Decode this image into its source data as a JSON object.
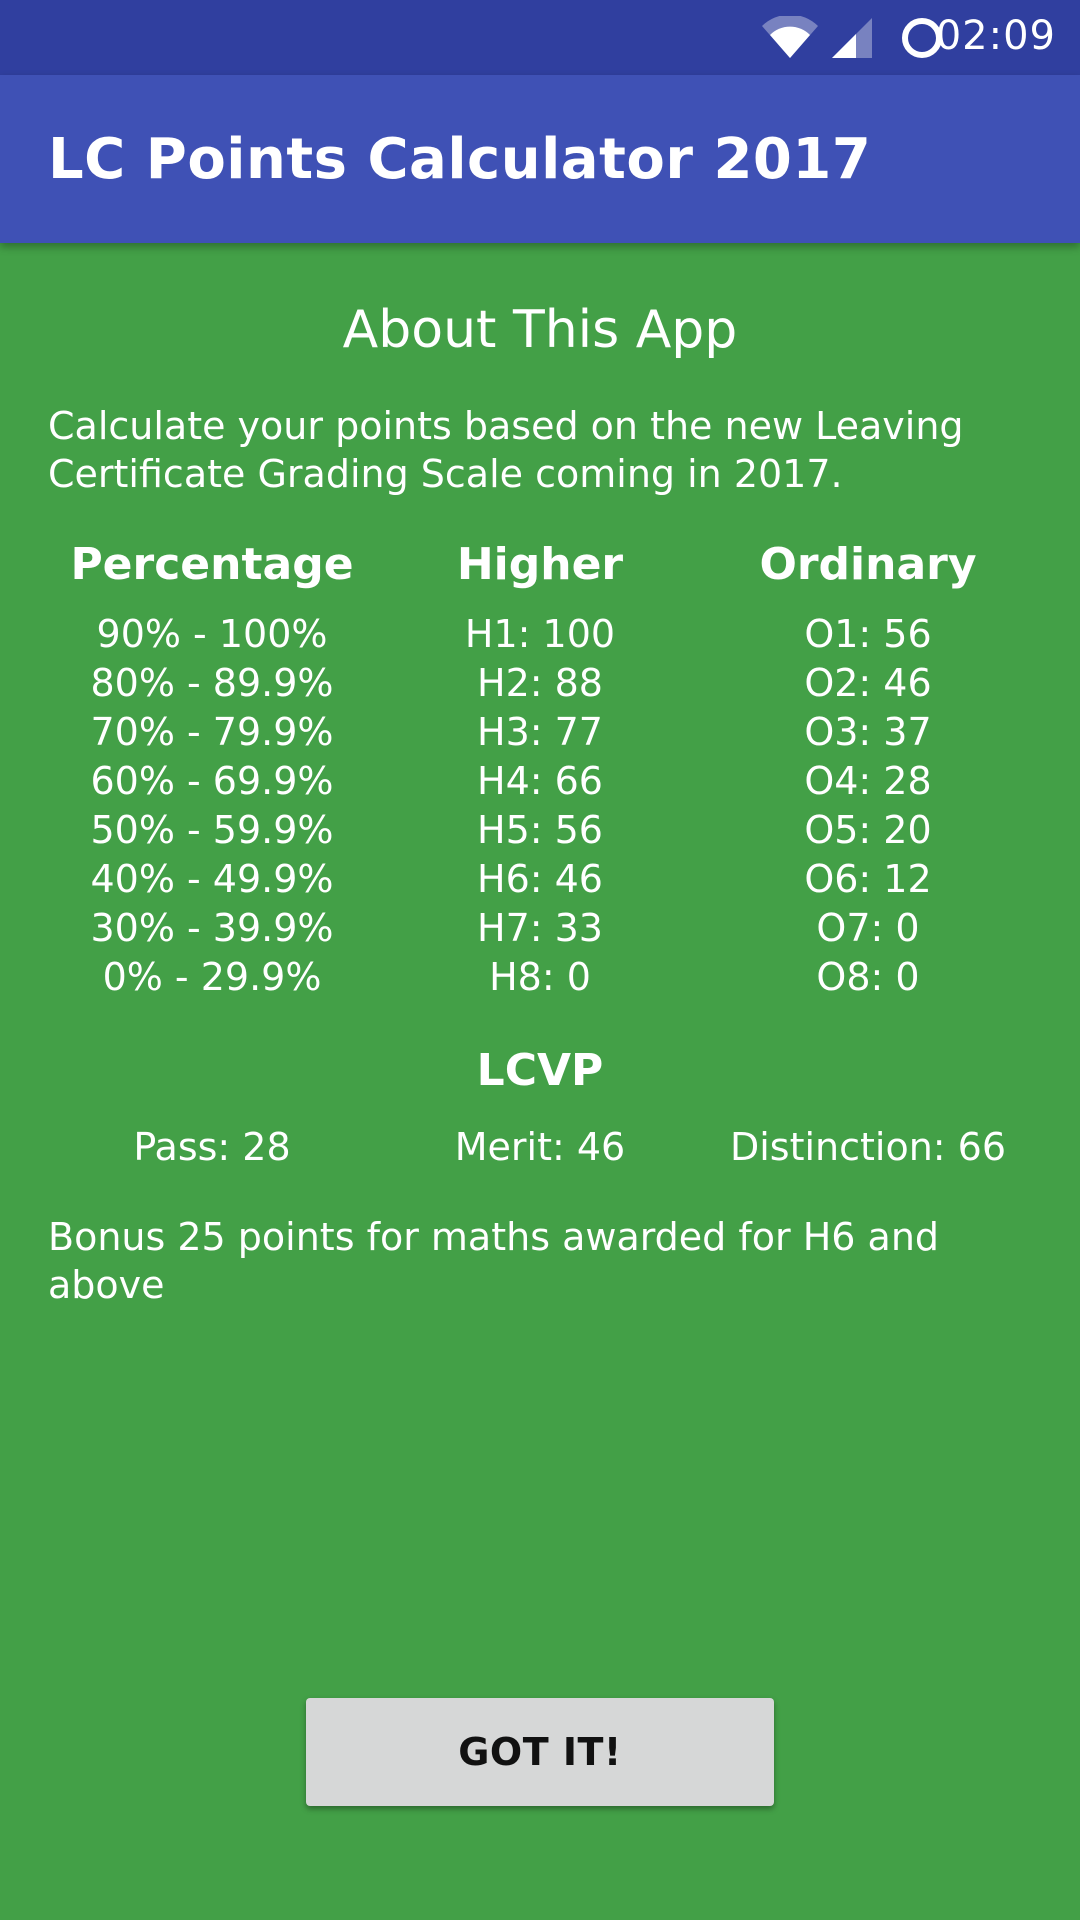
{
  "status_bar": {
    "time": "02:09",
    "icons": [
      "wifi-icon",
      "cell-signal-icon",
      "sync-icon"
    ]
  },
  "app_bar": {
    "title": "LC Points Calculator 2017"
  },
  "about": {
    "title": "About This App",
    "intro": "Calculate your points based on the new Leaving Certificate Grading Scale coming in 2017."
  },
  "table": {
    "headers": {
      "percentage": "Percentage",
      "higher": "Higher",
      "ordinary": "Ordinary"
    },
    "percentage": [
      "90% - 100%",
      "80% - 89.9%",
      "70% - 79.9%",
      "60% - 69.9%",
      "50% - 59.9%",
      "40% - 49.9%",
      "30% - 39.9%",
      "0% - 29.9%"
    ],
    "higher": [
      "H1: 100",
      "H2: 88",
      "H3: 77",
      "H4: 66",
      "H5: 56",
      "H6: 46",
      "H7: 33",
      "H8: 0"
    ],
    "ordinary": [
      "O1: 56",
      "O2: 46",
      "O3: 37",
      "O4: 28",
      "O5: 20",
      "O6: 12",
      "O7: 0",
      "O8: 0"
    ]
  },
  "lcvp": {
    "title": "LCVP",
    "pass": "Pass: 28",
    "merit": "Merit: 46",
    "distinction": "Distinction: 66"
  },
  "bonus": "Bonus 25 points for maths awarded for H6 and above",
  "button": {
    "label": "GOT IT!"
  },
  "colors": {
    "status_bar": "#303f9f",
    "app_bar": "#3f51b5",
    "background": "#43a047",
    "button": "#d6d7d7"
  }
}
